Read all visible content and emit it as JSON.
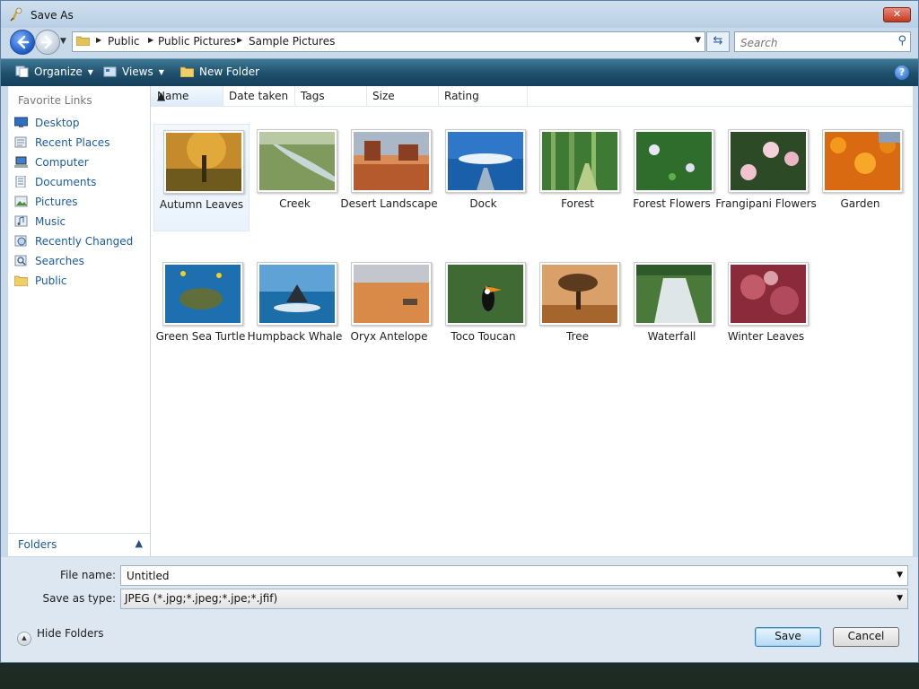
{
  "window": {
    "title": "Save As",
    "close_label": "✕"
  },
  "address": {
    "crumbs": [
      "Public",
      "Public Pictures",
      "Sample Pictures"
    ],
    "search_placeholder": "Search"
  },
  "toolbar": {
    "organize_label": "Organize",
    "views_label": "Views",
    "new_folder_label": "New Folder",
    "help_label": "?"
  },
  "sidebar": {
    "title": "Favorite Links",
    "items": [
      {
        "label": "Desktop",
        "icon": "desktop-icon"
      },
      {
        "label": "Recent Places",
        "icon": "recent-places-icon"
      },
      {
        "label": "Computer",
        "icon": "computer-icon"
      },
      {
        "label": "Documents",
        "icon": "documents-icon"
      },
      {
        "label": "Pictures",
        "icon": "pictures-icon"
      },
      {
        "label": "Music",
        "icon": "music-icon"
      },
      {
        "label": "Recently Changed",
        "icon": "recently-changed-icon"
      },
      {
        "label": "Searches",
        "icon": "searches-icon"
      },
      {
        "label": "Public",
        "icon": "folder-icon"
      }
    ],
    "folders_label": "Folders"
  },
  "columns": [
    "Name",
    "Date taken",
    "Tags",
    "Size",
    "Rating"
  ],
  "files": [
    {
      "name": "Autumn Leaves"
    },
    {
      "name": "Creek"
    },
    {
      "name": "Desert Landscape"
    },
    {
      "name": "Dock"
    },
    {
      "name": "Forest"
    },
    {
      "name": "Forest Flowers"
    },
    {
      "name": "Frangipani Flowers"
    },
    {
      "name": "Garden"
    },
    {
      "name": "Green Sea Turtle"
    },
    {
      "name": "Humpback Whale"
    },
    {
      "name": "Oryx Antelope"
    },
    {
      "name": "Toco Toucan"
    },
    {
      "name": "Tree"
    },
    {
      "name": "Waterfall"
    },
    {
      "name": "Winter Leaves"
    }
  ],
  "form": {
    "filename_label": "File name:",
    "filename_value": "Untitled",
    "type_label": "Save as type:",
    "type_value": "JPEG (*.jpg;*.jpeg;*.jpe;*.jfif)",
    "hide_folders_label": "Hide Folders",
    "save_label": "Save",
    "cancel_label": "Cancel"
  },
  "colors": {
    "toolbar": "#1e4f6b",
    "link": "#1a5b9c",
    "accent": "#3c7fb1"
  }
}
